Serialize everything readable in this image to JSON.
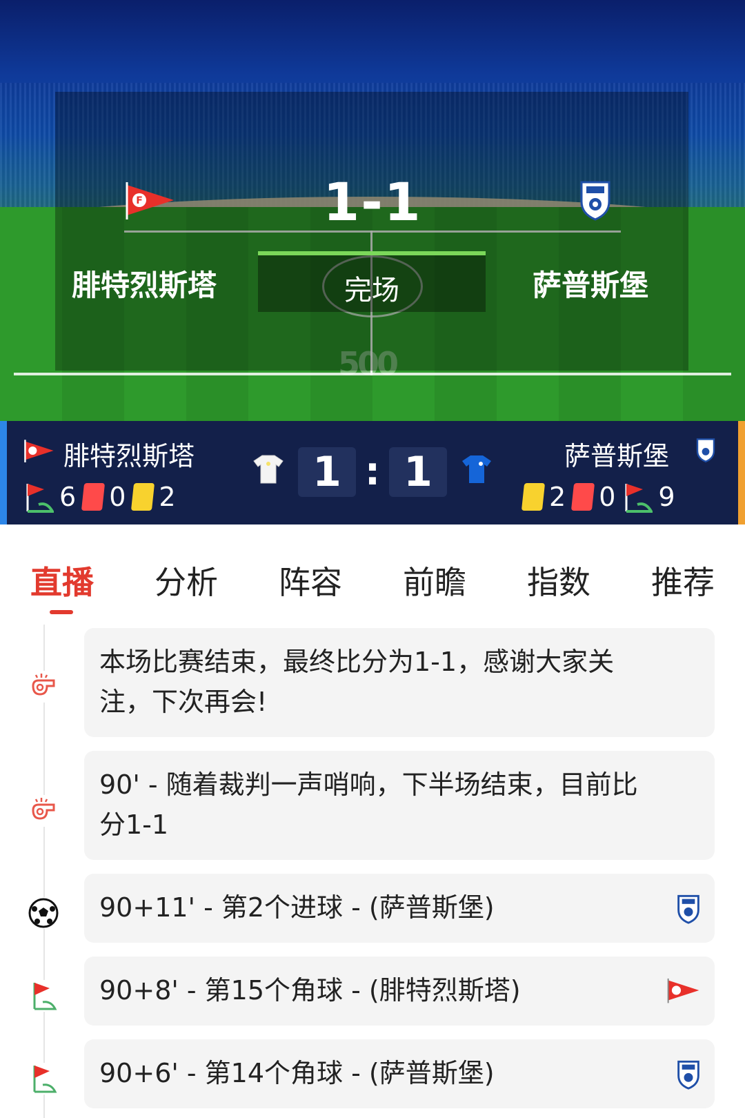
{
  "match": {
    "home_team": "腓特烈斯塔",
    "away_team": "萨普斯堡",
    "hero_score": "1-1",
    "status": "完场",
    "home_score": "1",
    "away_score": "1",
    "score_separator": ":",
    "hero_watermark": "500"
  },
  "home_stats": {
    "corners": "6",
    "red_cards": "0",
    "yellow_cards": "2"
  },
  "away_stats": {
    "yellow_cards": "2",
    "red_cards": "0",
    "corners": "9"
  },
  "colors": {
    "accent": "#e23a2e",
    "scorebar_bg": "#13204a",
    "home_edge": "#2d86e8",
    "away_edge": "#f0a030",
    "red_card": "#ff4a4a",
    "yellow_card": "#f8d22e"
  },
  "tabs": [
    {
      "label": "直播",
      "active": true
    },
    {
      "label": "分析",
      "active": false
    },
    {
      "label": "阵容",
      "active": false
    },
    {
      "label": "前瞻",
      "active": false
    },
    {
      "label": "指数",
      "active": false
    },
    {
      "label": "推荐",
      "active": false
    }
  ],
  "events": [
    {
      "icon": "whistle-icon",
      "text": "本场比赛结束，最终比分为1-1，感谢大家关注，下次再会!",
      "team": null
    },
    {
      "icon": "whistle-icon",
      "text": "90' - 随着裁判一声哨响，下半场结束，目前比分1-1",
      "team": null
    },
    {
      "icon": "soccer-ball-icon",
      "text": "90+11' - 第2个进球 - (萨普斯堡)",
      "team": "away"
    },
    {
      "icon": "corner-flag-icon",
      "text": "90+8' - 第15个角球 - (腓特烈斯塔)",
      "team": "home"
    },
    {
      "icon": "corner-flag-icon",
      "text": "90+6' - 第14个角球 - (萨普斯堡)",
      "team": "away"
    }
  ]
}
